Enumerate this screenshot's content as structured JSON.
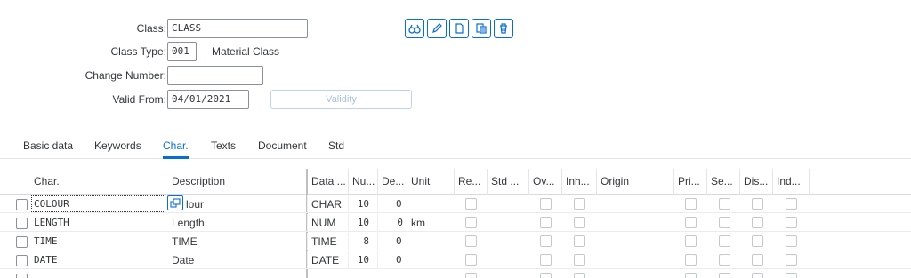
{
  "header": {
    "class_label": "Class:",
    "class_value": "CLASS",
    "class_type_label": "Class Type:",
    "class_type_value": "001",
    "class_type_text": "Material Class",
    "change_number_label": "Change Number:",
    "change_number_value": "",
    "valid_from_label": "Valid From:",
    "valid_from_value": "04/01/2021",
    "validity_button": "Validity"
  },
  "toolbar": {
    "icons": [
      "display-icon",
      "edit-icon",
      "create-icon",
      "copy-icon",
      "delete-icon"
    ]
  },
  "tabs": [
    {
      "label": "Basic data",
      "active": false
    },
    {
      "label": "Keywords",
      "active": false
    },
    {
      "label": "Char.",
      "active": true
    },
    {
      "label": "Texts",
      "active": false
    },
    {
      "label": "Document",
      "active": false
    },
    {
      "label": "Std",
      "active": false
    }
  ],
  "grid": {
    "columns": [
      "Char.",
      "Description",
      "Data ...",
      "Nu...",
      "De...",
      "Unit",
      "Re...",
      "Std ...",
      "Ov...",
      "Inh...",
      "Origin",
      "Pri...",
      "Se...",
      "Dis...",
      "Ind..."
    ],
    "rows": [
      {
        "char": "COLOUR",
        "description": "lour",
        "data_type": "CHAR",
        "num": "10",
        "dec": "0",
        "unit": ""
      },
      {
        "char": "LENGTH",
        "description": "Length",
        "data_type": "NUM",
        "num": "10",
        "dec": "0",
        "unit": "km"
      },
      {
        "char": "TIME",
        "description": "TIME",
        "data_type": "TIME",
        "num": "8",
        "dec": "0",
        "unit": ""
      },
      {
        "char": "DATE",
        "description": "Date",
        "data_type": "DATE",
        "num": "10",
        "dec": "0",
        "unit": ""
      }
    ]
  },
  "colors": {
    "accent": "#0a6ed1",
    "text": "#32363a",
    "border": "#89919a"
  }
}
